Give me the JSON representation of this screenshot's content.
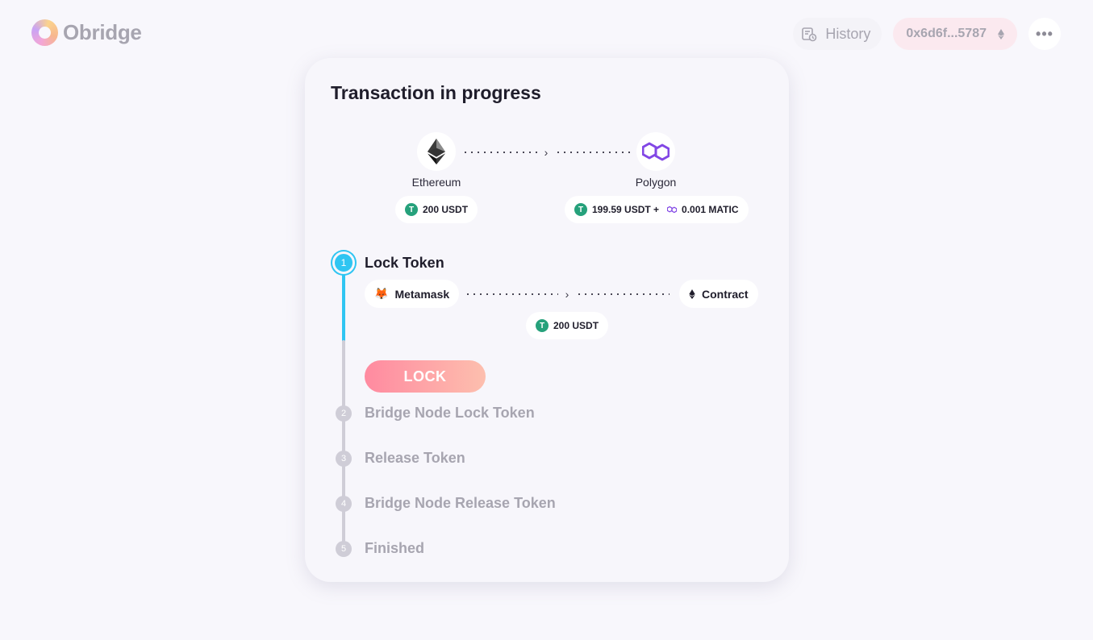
{
  "header": {
    "logo_text": "Obridge",
    "history_label": "History",
    "wallet_address": "0x6d6f...5787",
    "more_label": "•••"
  },
  "card": {
    "title": "Transaction in progress",
    "from_chain": {
      "name": "Ethereum",
      "icon": "ethereum-icon",
      "amount": "200 USDT"
    },
    "to_chain": {
      "name": "Polygon",
      "icon": "polygon-icon",
      "amount": "199.59 USDT +",
      "fee_amount": "0.001 MATIC"
    },
    "connector_arrow": "›"
  },
  "steps": [
    {
      "number": "1",
      "label": "Lock Token",
      "status": "active"
    },
    {
      "number": "2",
      "label": "Bridge Node Lock Token",
      "status": "pending"
    },
    {
      "number": "3",
      "label": "Release Token",
      "status": "pending"
    },
    {
      "number": "4",
      "label": "Bridge Node Release Token",
      "status": "pending"
    },
    {
      "number": "5",
      "label": "Finished",
      "status": "pending"
    }
  ],
  "lock_step": {
    "source": "Metamask",
    "destination": "Contract",
    "amount": "200 USDT",
    "action_label": "LOCK"
  },
  "token_symbol_glyph": "T",
  "colors": {
    "accent_blue": "#2fc5f2",
    "tether_green": "#26a17b",
    "polygon_purple": "#8247e5",
    "lock_gradient_start": "#ff8aa0",
    "lock_gradient_end": "#fdbfae"
  }
}
